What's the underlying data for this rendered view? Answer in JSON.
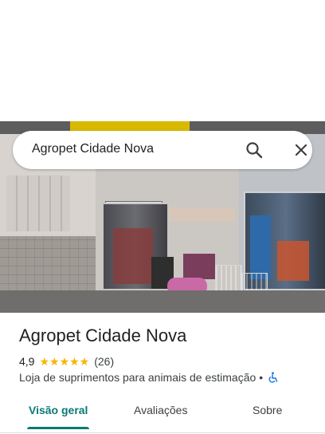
{
  "search": {
    "query": "Agropet Cidade Nova"
  },
  "place": {
    "title": "Agropet Cidade Nova",
    "rating": "4,9",
    "stars": "★★★★★",
    "review_count": "(26)",
    "category": "Loja de suprimentos para animais de estimação",
    "separator": "•",
    "accessibility_icon": "wheelchair-icon"
  },
  "tabs": [
    {
      "label": "Visão geral",
      "active": true
    },
    {
      "label": "Avaliações",
      "active": false
    },
    {
      "label": "Sobre",
      "active": false
    }
  ],
  "colors": {
    "accent": "#0b7a75",
    "star": "#f7b500",
    "accessibility": "#1a73e8"
  }
}
